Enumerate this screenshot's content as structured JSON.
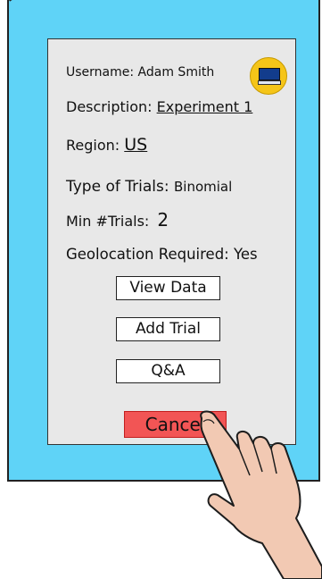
{
  "colors": {
    "device_bg": "#5fd3f7",
    "panel_bg": "#e8e8e8",
    "cancel_bg": "#f25555",
    "avatar_bg": "#f5c518"
  },
  "profile": {
    "username_label": "Username:",
    "username_value": "Adam Smith",
    "avatar_icon": "computer-monitor-icon"
  },
  "fields": {
    "description_label": "Description:",
    "description_value": "Experiment 1",
    "region_label": "Region:",
    "region_value": "US",
    "trials_label": "Type of Trials:",
    "trials_value": "Binomial",
    "min_trials_label": "Min #Trials:",
    "min_trials_value": "2",
    "geo_label": "Geolocation Required:",
    "geo_value": "Yes"
  },
  "buttons": {
    "view_data": "View Data",
    "add_trial": "Add Trial",
    "qa": "Q&A",
    "cancel": "Cancel"
  },
  "overlay": {
    "pointer_icon": "pointing-hand-icon"
  }
}
